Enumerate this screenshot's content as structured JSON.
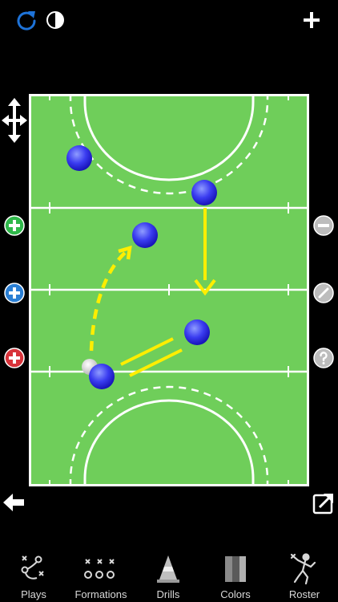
{
  "toolbar": {
    "items": [
      {
        "label": "Plays",
        "icon": "plays-icon"
      },
      {
        "label": "Formations",
        "icon": "formations-icon"
      },
      {
        "label": "Drills",
        "icon": "cone-icon"
      },
      {
        "label": "Colors",
        "icon": "colors-icon"
      },
      {
        "label": "Roster",
        "icon": "player-icon"
      }
    ]
  },
  "colors": {
    "background": "#000000",
    "field": "#6fce5a",
    "accent_blue": "#1e73d8",
    "arrow": "#ffee00",
    "player": "#2a2ee6",
    "add_green": "#2fb84a",
    "add_blue": "#2a7fd4",
    "add_red": "#d8333a"
  },
  "icons": {
    "top_left": [
      "refresh-icon",
      "contrast-icon"
    ],
    "top_right": "plus-icon",
    "left_side": [
      "move-arrows-icon",
      "add-green-player-icon",
      "add-blue-player-icon",
      "add-red-player-icon"
    ],
    "right_side": [
      "remove-icon",
      "edit-icon",
      "help-icon"
    ],
    "bottom_left": "back-arrow-icon",
    "bottom_right": "share-icon"
  }
}
